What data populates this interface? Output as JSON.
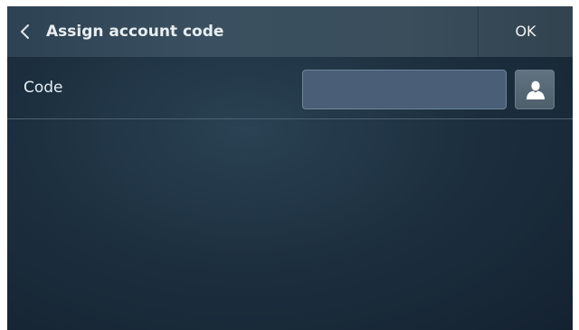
{
  "header": {
    "title": "Assign account code",
    "back_icon": "chevron-left-icon",
    "ok_label": "OK"
  },
  "code_field": {
    "label": "Code",
    "value": "",
    "contact_icon": "person-icon"
  },
  "colors": {
    "header_bg": "#3a5060",
    "screen_bg": "#1d3040",
    "input_bg": "#4a5e77",
    "text": "#e8eef2"
  }
}
